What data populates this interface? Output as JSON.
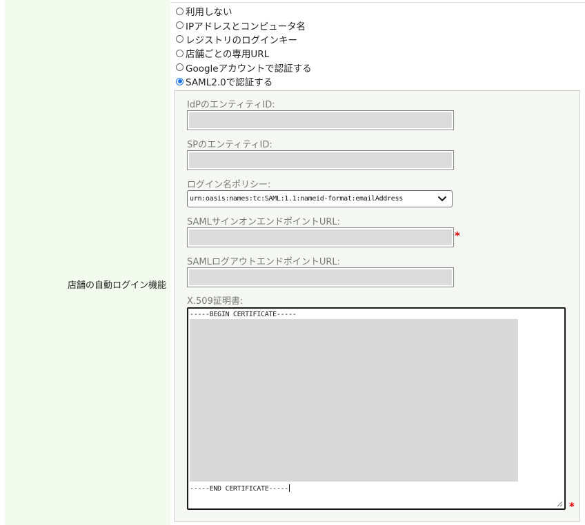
{
  "row_label": "店舗の自動ログイン機能",
  "login_options": [
    {
      "label": "利用しない",
      "checked": false
    },
    {
      "label": "IPアドレスとコンピュータ名",
      "checked": false
    },
    {
      "label": "レジストリのログインキー",
      "checked": false
    },
    {
      "label": "店舗ごとの専用URL",
      "checked": false
    },
    {
      "label": "Googleアカウントで認証する",
      "checked": false
    },
    {
      "label": "SAML2.0で認証する",
      "checked": true
    }
  ],
  "saml": {
    "idp_entity_id": {
      "label": "IdPのエンティティID:",
      "value": ""
    },
    "sp_entity_id": {
      "label": "SPのエンティティID:",
      "value": ""
    },
    "login_name_policy": {
      "label": "ログイン名ポリシー:",
      "selected": "urn:oasis:names:tc:SAML:1.1:nameid-format:emailAddress"
    },
    "signon_url": {
      "label": "SAMLサインオンエンドポイントURL:",
      "value": "",
      "required_mark": "*"
    },
    "logout_url": {
      "label": "SAMLログアウトエンドポイントURL:",
      "value": ""
    },
    "certificate": {
      "label": "X.509証明書:",
      "begin": "-----BEGIN CERTIFICATE-----",
      "end": "-----END CERTIFICATE-----",
      "required_mark": "*"
    }
  },
  "colors": {
    "label_column_bg": "#f2fbee",
    "panel_bg": "#f4f7f4",
    "redacted_fill": "#dcdcdc",
    "radio_selected": "#1a73e8",
    "required": "#e00000"
  },
  "icons": {
    "select_arrow": "chevron-down-icon",
    "textarea_resize": "resize-grip-icon"
  }
}
